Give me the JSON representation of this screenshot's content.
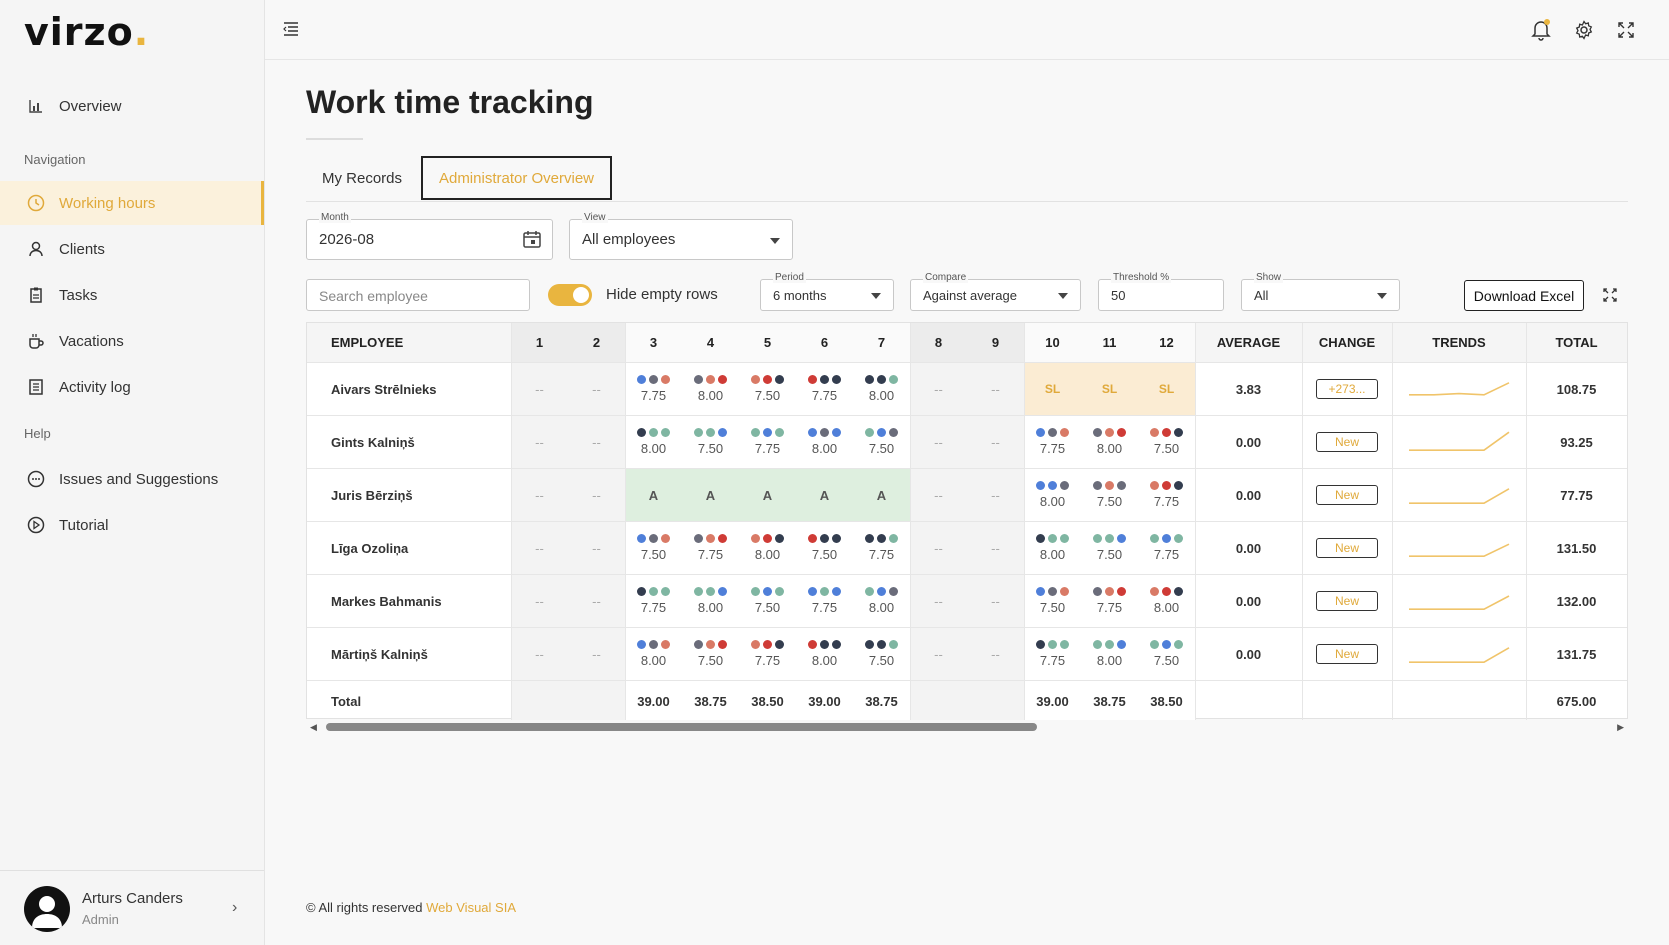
{
  "app": {
    "logo": "virzo",
    "logo_dot": "."
  },
  "sidebar": {
    "overview": "Overview",
    "navigation_label": "Navigation",
    "items": [
      {
        "label": "Working hours",
        "icon": "clock-icon",
        "active": true
      },
      {
        "label": "Clients",
        "icon": "person-icon"
      },
      {
        "label": "Tasks",
        "icon": "clipboard-icon"
      },
      {
        "label": "Vacations",
        "icon": "cup-icon"
      },
      {
        "label": "Activity log",
        "icon": "list-icon"
      }
    ],
    "help_label": "Help",
    "help_items": [
      {
        "label": "Issues and Suggestions",
        "icon": "chat-icon"
      },
      {
        "label": "Tutorial",
        "icon": "play-icon"
      }
    ],
    "user": {
      "name": "Arturs Canders",
      "role": "Admin"
    }
  },
  "page": {
    "title": "Work time tracking"
  },
  "tabs": [
    "My Records",
    "Administrator Overview"
  ],
  "filters": {
    "month_label": "Month",
    "month_value": "2026-08",
    "view_label": "View",
    "view_value": "All employees",
    "search_placeholder": "Search employee",
    "hide_empty_label": "Hide empty rows",
    "period_label": "Period",
    "period_value": "6 months",
    "compare_label": "Compare",
    "compare_value": "Against average",
    "threshold_label": "Threshold %",
    "threshold_value": "50",
    "show_label": "Show",
    "show_value": "All",
    "download_label": "Download Excel"
  },
  "colors": {
    "accent": "#e9b53f",
    "dark": "#333d4f",
    "red": "#cf3b36",
    "coral": "#d97a66",
    "blue": "#4f7fd9",
    "green": "#7fb6a2",
    "gray": "#6a6c7a"
  },
  "table": {
    "headers": {
      "employee": "EMPLOYEE",
      "days": [
        "1",
        "2",
        "3",
        "4",
        "5",
        "6",
        "7",
        "8",
        "9",
        "10",
        "11",
        "12"
      ],
      "average": "AVERAGE",
      "change": "CHANGE",
      "trends": "TRENDS",
      "total": "TOTAL"
    },
    "rows": [
      {
        "name": "Aivars Strēlnieks",
        "cells": [
          {
            "t": "dash"
          },
          {
            "t": "dash"
          },
          {
            "t": "h",
            "d": [
              "blue",
              "gray",
              "coral"
            ],
            "v": "7.75"
          },
          {
            "t": "h",
            "d": [
              "gray",
              "coral",
              "red"
            ],
            "v": "8.00"
          },
          {
            "t": "h",
            "d": [
              "coral",
              "red",
              "dark"
            ],
            "v": "7.50"
          },
          {
            "t": "h",
            "d": [
              "red",
              "dark",
              "dark"
            ],
            "v": "7.75"
          },
          {
            "t": "h",
            "d": [
              "dark",
              "dark",
              "green"
            ],
            "v": "8.00"
          },
          {
            "t": "dash"
          },
          {
            "t": "dash"
          },
          {
            "t": "sl",
            "v": "SL"
          },
          {
            "t": "sl",
            "v": "SL"
          },
          {
            "t": "sl",
            "v": "SL"
          }
        ],
        "average": "3.83",
        "change": "+273...",
        "total": "108.75",
        "trend": [
          0.3,
          0.3,
          0.35,
          0.3,
          0.8
        ]
      },
      {
        "name": "Gints Kalniņš",
        "cells": [
          {
            "t": "dash"
          },
          {
            "t": "dash"
          },
          {
            "t": "h",
            "d": [
              "dark",
              "green",
              "green"
            ],
            "v": "8.00"
          },
          {
            "t": "h",
            "d": [
              "green",
              "green",
              "blue"
            ],
            "v": "7.50"
          },
          {
            "t": "h",
            "d": [
              "green",
              "blue",
              "green"
            ],
            "v": "7.75"
          },
          {
            "t": "h",
            "d": [
              "blue",
              "gray",
              "blue"
            ],
            "v": "8.00"
          },
          {
            "t": "h",
            "d": [
              "green",
              "blue",
              "gray"
            ],
            "v": "7.50"
          },
          {
            "t": "dash"
          },
          {
            "t": "dash"
          },
          {
            "t": "h",
            "d": [
              "blue",
              "gray",
              "coral"
            ],
            "v": "7.75"
          },
          {
            "t": "h",
            "d": [
              "gray",
              "coral",
              "red"
            ],
            "v": "8.00"
          },
          {
            "t": "h",
            "d": [
              "coral",
              "red",
              "dark"
            ],
            "v": "7.50"
          }
        ],
        "average": "0.00",
        "change": "New",
        "total": "93.25",
        "trend": [
          0.2,
          0.2,
          0.2,
          0.2,
          0.95
        ]
      },
      {
        "name": "Juris Bērziņš",
        "cells": [
          {
            "t": "dash"
          },
          {
            "t": "dash"
          },
          {
            "t": "a",
            "v": "A"
          },
          {
            "t": "a",
            "v": "A"
          },
          {
            "t": "a",
            "v": "A"
          },
          {
            "t": "a",
            "v": "A"
          },
          {
            "t": "a",
            "v": "A"
          },
          {
            "t": "dash"
          },
          {
            "t": "dash"
          },
          {
            "t": "h",
            "d": [
              "blue",
              "blue",
              "gray"
            ],
            "v": "8.00"
          },
          {
            "t": "h",
            "d": [
              "gray",
              "coral",
              "gray"
            ],
            "v": "7.50"
          },
          {
            "t": "h",
            "d": [
              "coral",
              "red",
              "dark"
            ],
            "v": "7.75"
          }
        ],
        "average": "0.00",
        "change": "New",
        "total": "77.75",
        "trend": [
          0.2,
          0.2,
          0.2,
          0.2,
          0.8
        ]
      },
      {
        "name": "Līga Ozoliņa",
        "cells": [
          {
            "t": "dash"
          },
          {
            "t": "dash"
          },
          {
            "t": "h",
            "d": [
              "blue",
              "gray",
              "coral"
            ],
            "v": "7.50"
          },
          {
            "t": "h",
            "d": [
              "gray",
              "coral",
              "red"
            ],
            "v": "7.75"
          },
          {
            "t": "h",
            "d": [
              "coral",
              "red",
              "dark"
            ],
            "v": "8.00"
          },
          {
            "t": "h",
            "d": [
              "red",
              "dark",
              "dark"
            ],
            "v": "7.50"
          },
          {
            "t": "h",
            "d": [
              "dark",
              "dark",
              "green"
            ],
            "v": "7.75"
          },
          {
            "t": "dash"
          },
          {
            "t": "dash"
          },
          {
            "t": "h",
            "d": [
              "dark",
              "green",
              "green"
            ],
            "v": "8.00"
          },
          {
            "t": "h",
            "d": [
              "green",
              "green",
              "blue"
            ],
            "v": "7.50"
          },
          {
            "t": "h",
            "d": [
              "green",
              "blue",
              "green"
            ],
            "v": "7.75"
          }
        ],
        "average": "0.00",
        "change": "New",
        "total": "131.50",
        "trend": [
          0.2,
          0.2,
          0.2,
          0.2,
          0.7
        ]
      },
      {
        "name": "Markes Bahmanis",
        "cells": [
          {
            "t": "dash"
          },
          {
            "t": "dash"
          },
          {
            "t": "h",
            "d": [
              "dark",
              "green",
              "green"
            ],
            "v": "7.75"
          },
          {
            "t": "h",
            "d": [
              "green",
              "green",
              "blue"
            ],
            "v": "8.00"
          },
          {
            "t": "h",
            "d": [
              "green",
              "blue",
              "green"
            ],
            "v": "7.50"
          },
          {
            "t": "h",
            "d": [
              "blue",
              "green",
              "blue"
            ],
            "v": "7.75"
          },
          {
            "t": "h",
            "d": [
              "green",
              "blue",
              "gray"
            ],
            "v": "8.00"
          },
          {
            "t": "dash"
          },
          {
            "t": "dash"
          },
          {
            "t": "h",
            "d": [
              "blue",
              "gray",
              "coral"
            ],
            "v": "7.50"
          },
          {
            "t": "h",
            "d": [
              "gray",
              "coral",
              "red"
            ],
            "v": "7.75"
          },
          {
            "t": "h",
            "d": [
              "coral",
              "red",
              "dark"
            ],
            "v": "8.00"
          }
        ],
        "average": "0.00",
        "change": "New",
        "total": "132.00",
        "trend": [
          0.2,
          0.2,
          0.2,
          0.2,
          0.75
        ]
      },
      {
        "name": "Mārtiņš Kalniņš",
        "cells": [
          {
            "t": "dash"
          },
          {
            "t": "dash"
          },
          {
            "t": "h",
            "d": [
              "blue",
              "gray",
              "coral"
            ],
            "v": "8.00"
          },
          {
            "t": "h",
            "d": [
              "gray",
              "coral",
              "red"
            ],
            "v": "7.50"
          },
          {
            "t": "h",
            "d": [
              "coral",
              "red",
              "dark"
            ],
            "v": "7.75"
          },
          {
            "t": "h",
            "d": [
              "red",
              "dark",
              "dark"
            ],
            "v": "8.00"
          },
          {
            "t": "h",
            "d": [
              "dark",
              "dark",
              "green"
            ],
            "v": "7.50"
          },
          {
            "t": "dash"
          },
          {
            "t": "dash"
          },
          {
            "t": "h",
            "d": [
              "dark",
              "green",
              "green"
            ],
            "v": "7.75"
          },
          {
            "t": "h",
            "d": [
              "green",
              "green",
              "blue"
            ],
            "v": "8.00"
          },
          {
            "t": "h",
            "d": [
              "green",
              "blue",
              "green"
            ],
            "v": "7.50"
          }
        ],
        "average": "0.00",
        "change": "New",
        "total": "131.75",
        "trend": [
          0.2,
          0.2,
          0.2,
          0.2,
          0.8
        ]
      }
    ],
    "totals": {
      "label": "Total",
      "days": [
        "",
        "",
        "39.00",
        "38.75",
        "38.50",
        "39.00",
        "38.75",
        "",
        "",
        "39.00",
        "38.75",
        "38.50"
      ],
      "total": "675.00"
    }
  },
  "footer": {
    "text": "© All rights reserved",
    "link": "Web Visual SIA"
  }
}
